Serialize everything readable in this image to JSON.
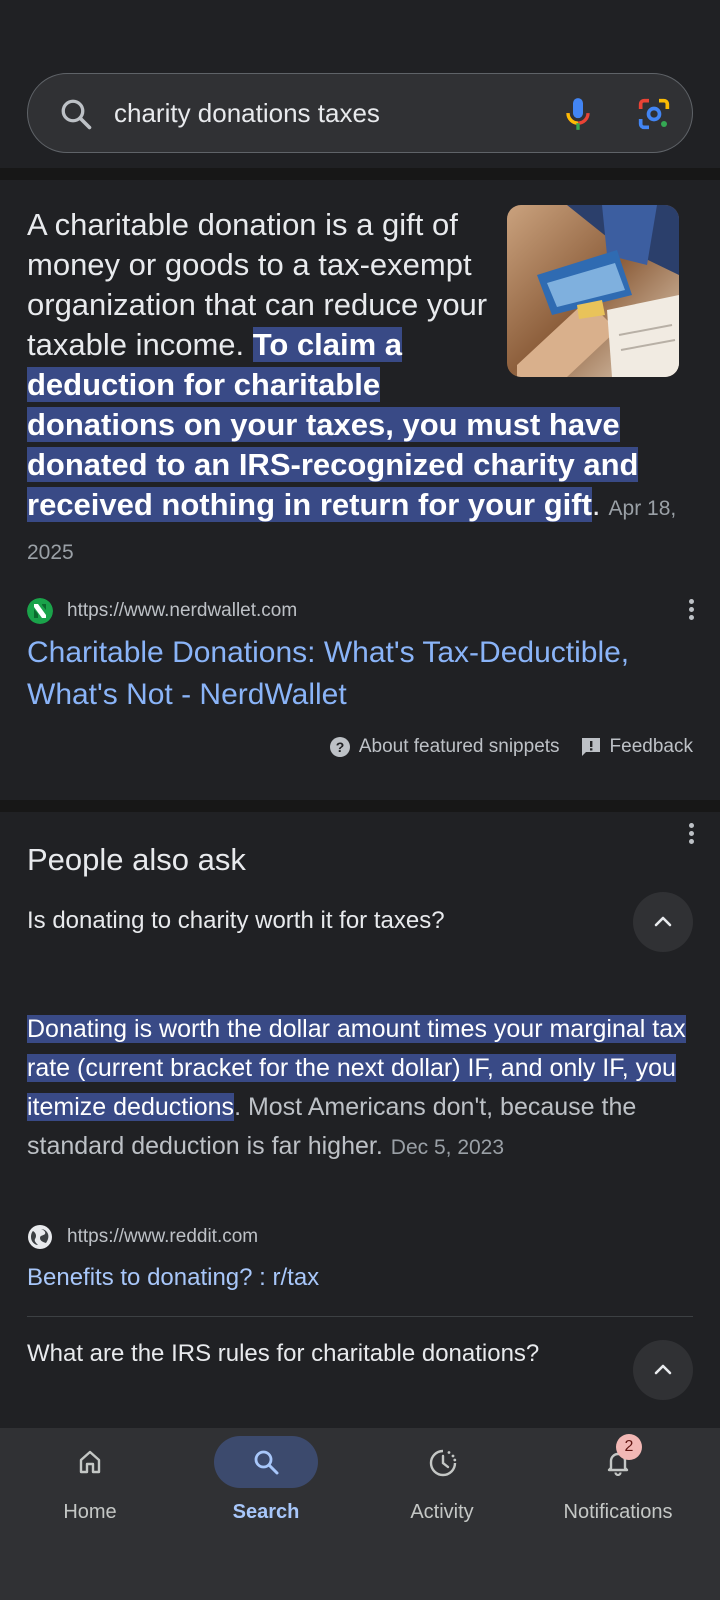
{
  "search": {
    "query": "charity donations taxes"
  },
  "featured_snippet": {
    "text_plain": "A charitable donation is a gift of money or goods to a tax-exempt organization that can reduce your taxable income. ",
    "text_highlight": "To claim a deduction for charitable donations on your taxes, you must have donated to an IRS-recognized charity and received nothing in return for your gift",
    "text_tail": ".",
    "date": "Apr 18, 2025",
    "source_url": "https://www.nerdwallet.com",
    "title": "Charitable Donations: What's Tax-Deductible, What's Not - NerdWallet",
    "about_label": "About featured snippets",
    "feedback_label": "Feedback"
  },
  "people_also_ask": {
    "title": "People also ask",
    "items": [
      {
        "question": "Is donating to charity worth it for taxes?",
        "answer_highlight": "Donating is worth the dollar amount times your marginal tax rate (current bracket for the next dollar) IF, and only IF, you itemize deductions",
        "answer_plain": ". Most Americans don't, because the standard deduction is far higher.",
        "date": "Dec 5, 2023",
        "source_url": "https://www.reddit.com",
        "link_title": "Benefits to donating? : r/tax"
      },
      {
        "question": "What are the IRS rules for charitable donations?"
      }
    ]
  },
  "bottom_nav": {
    "items": [
      {
        "label": "Home",
        "icon": "home-icon"
      },
      {
        "label": "Search",
        "icon": "search-icon",
        "active": true
      },
      {
        "label": "Activity",
        "icon": "activity-icon"
      },
      {
        "label": "Notifications",
        "icon": "bell-icon",
        "badge": "2"
      }
    ]
  },
  "colors": {
    "background": "#202124",
    "highlight": "#394a86",
    "link": "#8ab4f8",
    "nav_active": "#a8c7fa"
  }
}
